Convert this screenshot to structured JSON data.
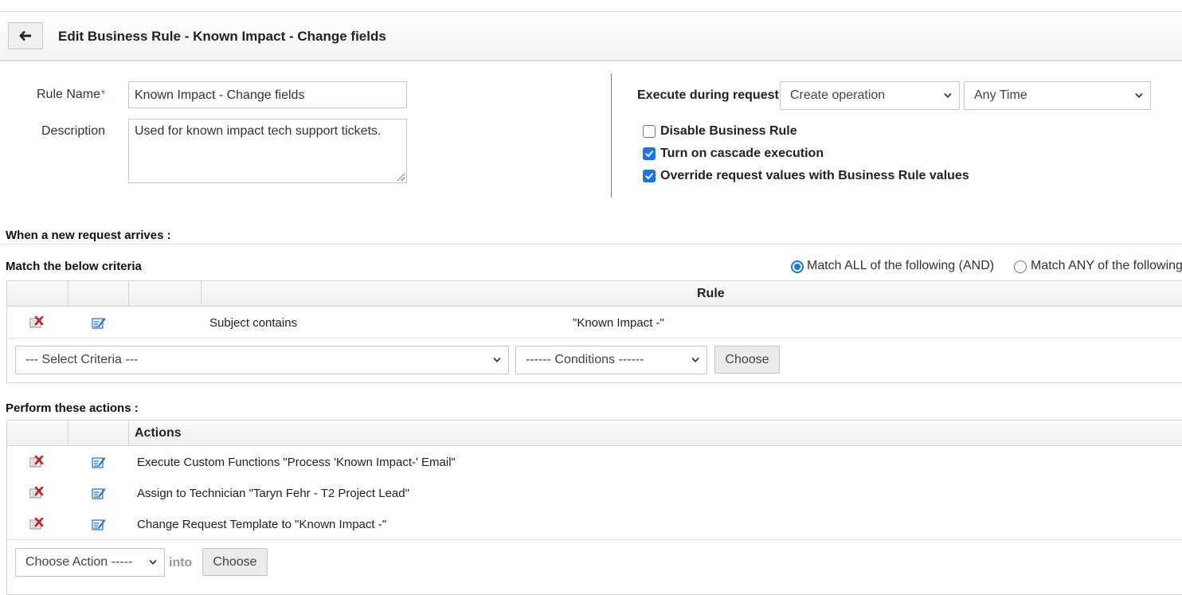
{
  "header": {
    "title": "Edit Business Rule - Known Impact - Change fields"
  },
  "form": {
    "rule_name_label": "Rule Name",
    "required_mark": "*",
    "rule_name_value": "Known Impact - Change fields",
    "description_label": "Description",
    "description_value": "Used for known impact tech support tickets."
  },
  "execution": {
    "label": "Execute during request",
    "operation_selected": "Create operation",
    "time_selected": "Any Time",
    "options": [
      {
        "label": "Disable Business Rule",
        "checked": false
      },
      {
        "label": "Turn on cascade execution",
        "checked": true
      },
      {
        "label": "Override request values with Business Rule values",
        "checked": true
      }
    ]
  },
  "criteria": {
    "arrives_label": "When a new request arrives :",
    "match_label": "Match the below criteria",
    "match_all_label": "Match ALL of the following (AND)",
    "match_any_label": "Match ANY of the following (OR)",
    "match_mode": "all",
    "column_header": "Rule",
    "rules": [
      {
        "field": "Subject contains",
        "value": "\"Known Impact -\""
      }
    ],
    "select_criteria_placeholder": "--- Select Criteria ---",
    "conditions_placeholder": "------ Conditions ------",
    "choose_label": "Choose"
  },
  "actions": {
    "section_label": "Perform these actions :",
    "column_header": "Actions",
    "items": [
      {
        "text": "Execute Custom Functions \"Process 'Known Impact-' Email\""
      },
      {
        "text": "Assign to Technician \"Taryn Fehr - T2 Project Lead\""
      },
      {
        "text": "Change Request Template to \"Known Impact -\""
      }
    ],
    "choose_action_placeholder": "Choose Action -----",
    "into_label": "into",
    "choose_label": "Choose"
  },
  "icons": {
    "back": "arrow-left-icon",
    "delete": "delete-icon",
    "edit": "edit-icon",
    "dropdown": "chevron-down-icon",
    "check": "checkmark-icon"
  },
  "colors": {
    "accent": "#1a73e8",
    "required": "#dd3333",
    "delete_icon": "#cc1f1f",
    "edit_icon": "#2b72c2"
  }
}
